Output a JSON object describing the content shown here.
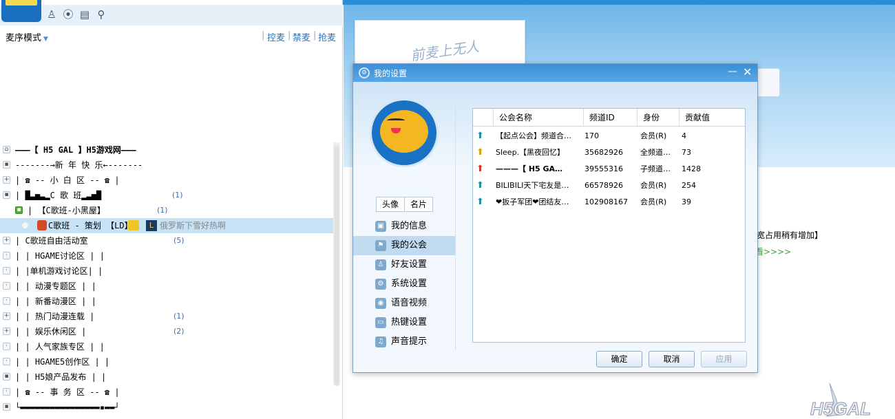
{
  "toolbar": {
    "icons": [
      "users-icon",
      "location-icon",
      "document-icon",
      "search-icon"
    ]
  },
  "left": {
    "mode_label": "麦序模式",
    "mode_links": [
      "控麦",
      "禁麦",
      "抢麦"
    ]
  },
  "tree": [
    {
      "icon": "home",
      "text": "———【 H5 GAL 】H5游戏网———",
      "count": ""
    },
    {
      "icon": "lock",
      "text": "-------→新 年 快 乐←-------",
      "count": ""
    },
    {
      "icon": "plus",
      "text": "|    ☎ -- 小 白 区 -- ☎     |",
      "count": ""
    },
    {
      "icon": "lock",
      "text": "|   █▃▅▃▂C 歌 班▂▃▅█  ",
      "count": "(1)"
    },
    {
      "icon": "green-lock",
      "text": "|    【C歌班-小黑屋】     ",
      "count": "(1)"
    },
    {
      "icon": "user",
      "text": "C歌班 - 策划 【LD】",
      "count": "",
      "extra": "俄罗斯下雪好热啊"
    },
    {
      "icon": "plus",
      "text": "|       C歌班自由活动室       ",
      "count": "(5)"
    },
    {
      "icon": "dot",
      "text": "|       |  HGAME讨论区 |      |",
      "count": ""
    },
    {
      "icon": "dot",
      "text": "|       |单机游戏讨论区|      |",
      "count": ""
    },
    {
      "icon": "dot",
      "text": "|       |  动漫专题区  |      |",
      "count": ""
    },
    {
      "icon": "dot",
      "text": "|       |  新番动漫区  |      |",
      "count": ""
    },
    {
      "icon": "plus",
      "text": "|       | 热门动漫连载 |      ",
      "count": "(1)"
    },
    {
      "icon": "plus",
      "text": "|       |  娱乐休闲区  |      ",
      "count": "(2)"
    },
    {
      "icon": "dot",
      "text": "|       | 人气家族专区 |      |",
      "count": ""
    },
    {
      "icon": "dot",
      "text": "|       | HGAME5创作区 |      |",
      "count": ""
    },
    {
      "icon": "lock",
      "text": "|       | H5娘产品发布 |      |",
      "count": ""
    },
    {
      "icon": "dot",
      "text": "|    ☎ -- 事 务 区 -- ☎    |",
      "count": ""
    },
    {
      "icon": "lock",
      "text": "└▬▬▬▬▬▬▬▬▬▬▬▬▬▬▬▬▪▬▬┘",
      "count": ""
    }
  ],
  "background": {
    "card_text": "前麦上无人",
    "notice": "宽占用稍有增加】",
    "notice2": "看>>>>"
  },
  "dialog": {
    "title": "我的设置",
    "avatar_tab": "头像",
    "card_tab": "名片",
    "nav": [
      {
        "label": "我的信息",
        "icon": "info-icon"
      },
      {
        "label": "我的公会",
        "icon": "flag-icon"
      },
      {
        "label": "好友设置",
        "icon": "friends-icon"
      },
      {
        "label": "系统设置",
        "icon": "gear-icon"
      },
      {
        "label": "语音视频",
        "icon": "camera-icon"
      },
      {
        "label": "热键设置",
        "icon": "keyboard-icon"
      },
      {
        "label": "声音提示",
        "icon": "music-icon"
      }
    ],
    "active_nav": 1,
    "table": {
      "headers": [
        "公会名称",
        "频道ID",
        "身份",
        "贡献值"
      ],
      "rows": [
        [
          "【起点公会】频道合…",
          "170",
          "会员(R)",
          "4"
        ],
        [
          "Sleep.【黑夜回忆】",
          "35682926",
          "全频道…",
          "73"
        ],
        [
          "———【 H5 GA…",
          "39555316",
          "子频道…",
          "1428"
        ],
        [
          "BILIBILI天下宅友是…",
          "66578926",
          "会员(R)",
          "254"
        ],
        [
          "❤扳子军团❤团结友…",
          "102908167",
          "会员(R)",
          "39"
        ]
      ]
    },
    "buttons": {
      "ok": "确定",
      "cancel": "取消",
      "apply": "应用"
    }
  }
}
